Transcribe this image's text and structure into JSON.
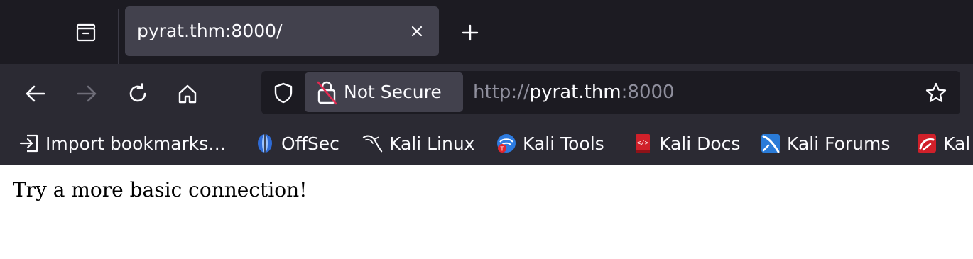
{
  "tab": {
    "title": "pyrat.thm:8000/",
    "list_icon": "tab-list-icon",
    "close_icon": "close-icon",
    "new_tab_icon": "plus-icon"
  },
  "navigation": {
    "back_icon": "arrow-left-icon",
    "forward_icon": "arrow-right-icon",
    "reload_icon": "reload-icon",
    "home_icon": "home-icon"
  },
  "urlbar": {
    "security_label": "Not Secure",
    "url_scheme": "http://",
    "url_host": "pyrat.thm",
    "url_port": ":8000",
    "shield_icon": "shield-icon",
    "insecure_icon": "lock-slashed-icon",
    "bookmark_icon": "star-icon"
  },
  "bookmarks": [
    {
      "label": "Import bookmarks…",
      "icon": "import-icon"
    },
    {
      "label": "OffSec",
      "icon": "offsec-icon"
    },
    {
      "label": "Kali Linux",
      "icon": "kali-dragon-icon"
    },
    {
      "label": "Kali Tools",
      "icon": "kali-tools-icon"
    },
    {
      "label": "Kali Docs",
      "icon": "kali-docs-icon"
    },
    {
      "label": "Kali Forums",
      "icon": "kali-forums-icon"
    },
    {
      "label": "Kal",
      "icon": "kali-nethunter-icon"
    }
  ],
  "page": {
    "message": "Try a more basic connection!"
  },
  "colors": {
    "tabbar_bg": "#1c1b22",
    "toolbar_bg": "#2b2a33",
    "tab_active_bg": "#42414d",
    "text_light": "#fbfbfe",
    "text_dim": "#8f8f9d"
  }
}
